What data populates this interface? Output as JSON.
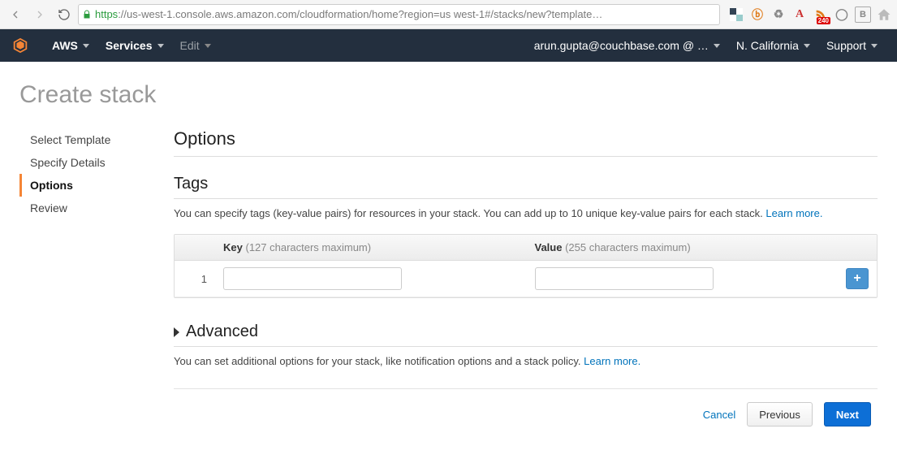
{
  "browser": {
    "url_proto": "https",
    "url_host_path": "://us-west-1.console.aws.amazon.com/cloudformation/home?region=us west-1#/stacks/new?template…",
    "rss_badge": "240"
  },
  "header": {
    "brand": "AWS",
    "services": "Services",
    "edit": "Edit",
    "account": "arun.gupta@couchbase.com @ …",
    "region": "N. California",
    "support": "Support"
  },
  "page": {
    "title": "Create stack",
    "sidebar": [
      {
        "label": "Select Template",
        "active": false
      },
      {
        "label": "Specify Details",
        "active": false
      },
      {
        "label": "Options",
        "active": true
      },
      {
        "label": "Review",
        "active": false
      }
    ],
    "options_heading": "Options",
    "tags": {
      "heading": "Tags",
      "desc": "You can specify tags (key-value pairs) for resources in your stack. You can add up to 10 unique key-value pairs for each stack. ",
      "learn": "Learn more.",
      "key_label": "Key",
      "key_hint": "(127 characters maximum)",
      "value_label": "Value",
      "value_hint": "(255 characters maximum)",
      "row_index": "1",
      "add_label": "+"
    },
    "advanced": {
      "heading": "Advanced",
      "desc": "You can set additional options for your stack, like notification options and a stack policy. ",
      "learn": "Learn more."
    },
    "footer": {
      "cancel": "Cancel",
      "previous": "Previous",
      "next": "Next"
    }
  }
}
